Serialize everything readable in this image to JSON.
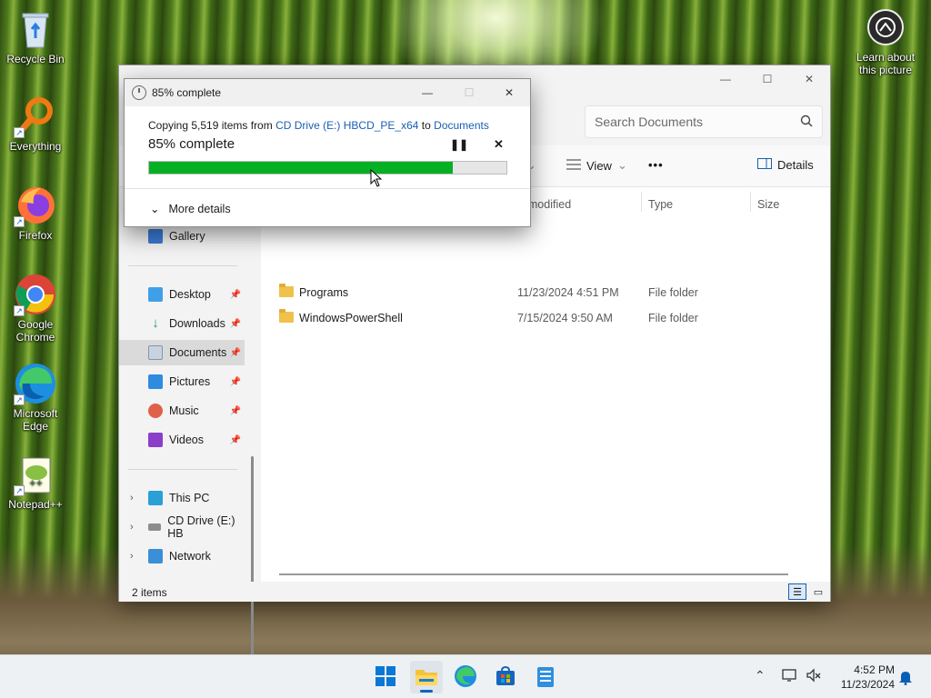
{
  "desktop": {
    "icons": [
      {
        "label": "Recycle Bin"
      },
      {
        "label": "Everything"
      },
      {
        "label": "Firefox"
      },
      {
        "label": "Google Chrome"
      },
      {
        "label": "Microsoft Edge"
      },
      {
        "label": "Notepad++"
      }
    ],
    "learn_label": "Learn about this picture"
  },
  "explorer": {
    "search_placeholder": "Search Documents",
    "toolbar": {
      "view_label": "View",
      "more_label": "•••",
      "details_label": "Details"
    },
    "nav": {
      "gallery": "Gallery",
      "desktop": "Desktop",
      "downloads": "Downloads",
      "documents": "Documents",
      "pictures": "Pictures",
      "music": "Music",
      "videos": "Videos",
      "this_pc": "This PC",
      "cd_drive": "CD Drive (E:) HB",
      "network": "Network"
    },
    "columns": {
      "date_modified": "te modified",
      "type": "Type",
      "size": "Size"
    },
    "rows": [
      {
        "name": "Programs",
        "date": "11/23/2024 4:51 PM",
        "type": "File folder"
      },
      {
        "name": "WindowsPowerShell",
        "date": "7/15/2024 9:50 AM",
        "type": "File folder"
      }
    ],
    "status": "2 items"
  },
  "copy_dialog": {
    "title": "85% complete",
    "copy_prefix": "Copying 5,519 items from",
    "source": "CD Drive (E:) HBCD_PE_x64",
    "to_word": "to",
    "destination": "Documents",
    "percent_text": "85% complete",
    "progress": 0.85,
    "more_details": "More details",
    "progress_color": "#06b025"
  },
  "taskbar": {
    "time": "4:52 PM",
    "date": "11/23/2024"
  }
}
